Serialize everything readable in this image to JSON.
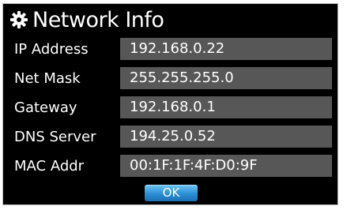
{
  "dialog": {
    "title": "Network Info",
    "title_icon": "gear-icon"
  },
  "fields": [
    {
      "label": "IP Address",
      "value": "192.168.0.22"
    },
    {
      "label": "Net Mask",
      "value": "255.255.255.0"
    },
    {
      "label": "Gateway",
      "value": "192.168.0.1"
    },
    {
      "label": "DNS Server",
      "value": "194.25.0.52"
    },
    {
      "label": "MAC Addr",
      "value": "00:1F:1F:4F:D0:9F"
    }
  ],
  "ok_label": "OK",
  "colors": {
    "dialog_background": "#000000",
    "field_background": "#575757",
    "button_accent": "#2b8fd4"
  }
}
